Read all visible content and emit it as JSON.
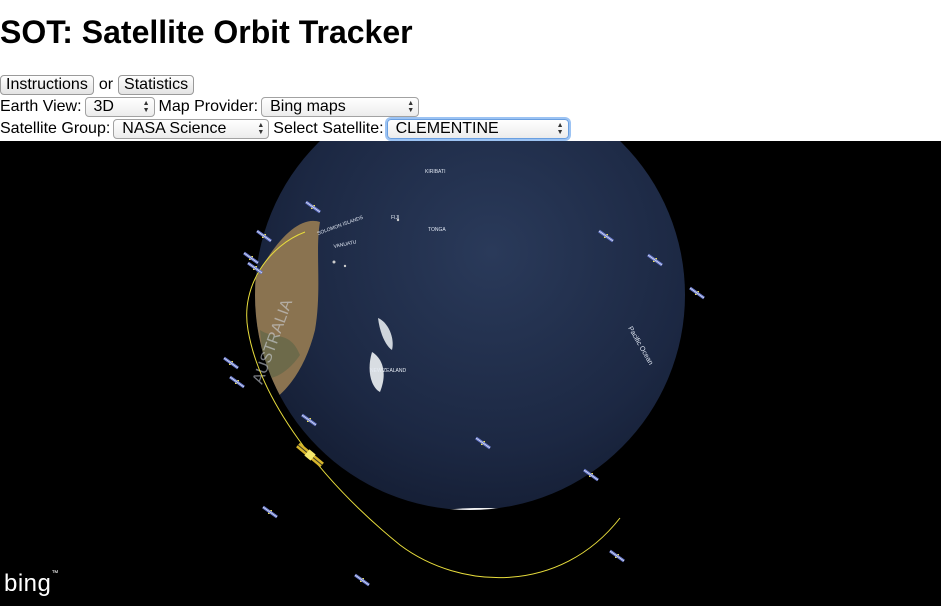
{
  "page": {
    "title": "SOT: Satellite Orbit Tracker"
  },
  "nav": {
    "instructions_label": "Instructions",
    "or_text": "or",
    "statistics_label": "Statistics"
  },
  "controls": {
    "earth_view_label": "Earth View:",
    "earth_view_value": "3D",
    "map_provider_label": "Map Provider:",
    "map_provider_value": "Bing maps",
    "satellite_group_label": "Satellite Group:",
    "satellite_group_value": "NASA Science",
    "select_satellite_label": "Select Satellite:",
    "select_satellite_value": "CLEMENTINE"
  },
  "globe": {
    "place_labels": [
      "KIRIBATI",
      "SOLOMON ISLANDS",
      "VANUATU",
      "FIJI",
      "TONGA",
      "NEW ZEALAND",
      "AUSTRALIA",
      "Pacific Ocean"
    ],
    "provider_logo": "bing",
    "colors": {
      "ocean": "#1e2b45",
      "space": "#000000",
      "orbit": "#e8dd3c",
      "antarctica": "#f4f4f4",
      "land": "#8a7350"
    }
  }
}
